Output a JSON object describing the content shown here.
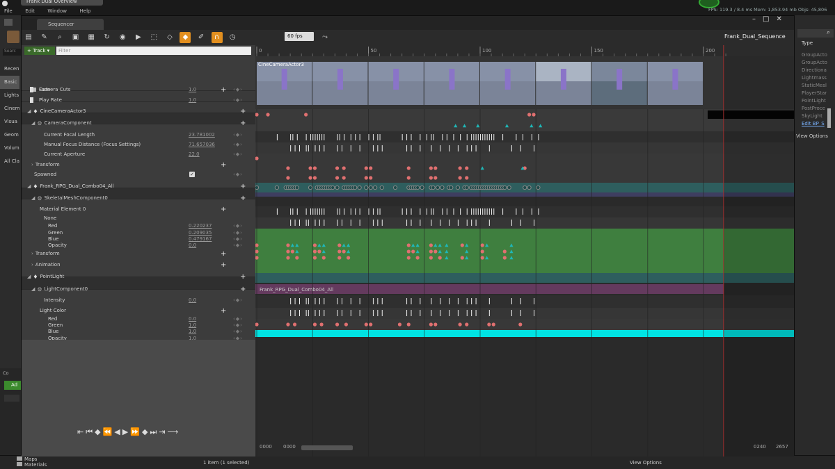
{
  "app": {
    "tab_title": "Frank Dual Overview",
    "menu": [
      "File",
      "Edit",
      "Window",
      "Help"
    ],
    "perf_text": "FPS: 119.3 / 8.4 ms  Mem: 1,853.94 mb  Objs: 45,806"
  },
  "left_panel": {
    "items": [
      "Recen",
      "Basic",
      "Lights",
      "Cinem",
      "Visua",
      "Geom",
      "Volum",
      "All Cla"
    ],
    "search_placeholder": "Searc"
  },
  "right_panel": {
    "type_header": "Type",
    "items": [
      "GroupActo",
      "GroupActo",
      "Directiona",
      "Lightmass",
      "StaticMesl",
      "PlayerStar",
      "PointLight",
      "PostProce",
      "SkyLight",
      "Edit BP_S"
    ],
    "view_options": "View Options"
  },
  "content_browser": {
    "tab": "Co",
    "add_label": "Ad",
    "folders": [
      "Maps",
      "Materials"
    ],
    "status": "1 item (1 selected)",
    "view_options": "View Options"
  },
  "sequencer": {
    "tab_title": "Sequencer",
    "sequence_name": "Frank_Dual_Sequence",
    "fps_label": "60 fps",
    "track_button": "Track",
    "filter_placeholder": "Filter",
    "ruler": [
      "0",
      "50",
      "100",
      "150",
      "200"
    ],
    "camera_cuts": "Camera Cuts",
    "camera_label": "CineCameraActor3",
    "rows": {
      "fade": {
        "label": "Fade",
        "value": "1.0"
      },
      "play_rate": {
        "label": "Play Rate",
        "value": "1.0"
      },
      "cine_camera": {
        "label": "CineCameraActor3"
      },
      "camera_component": {
        "label": "CameraComponent"
      },
      "focal_length": {
        "label": "Current Focal Length",
        "value": "23.781002"
      },
      "manual_focus": {
        "label": "Manual Focus Distance (Focus Settings)",
        "value": "71.657036"
      },
      "aperture": {
        "label": "Current Aperture",
        "value": "22.0"
      },
      "transform_cam": {
        "label": "Transform"
      },
      "spawned": {
        "label": "Spawned"
      },
      "frank_actor": {
        "label": "Frank_RPG_Dual_Combo04_All"
      },
      "skeletal": {
        "label": "SkeletalMeshComponent0"
      },
      "material": {
        "label": "Material Element 0"
      },
      "none": {
        "label": "None"
      },
      "red": {
        "label": "Red",
        "value": "0.220237"
      },
      "green": {
        "label": "Green",
        "value": "0.209035"
      },
      "blue": {
        "label": "Blue",
        "value": "0.479167"
      },
      "opacity": {
        "label": "Opacity",
        "value": "0.0"
      },
      "transform_frank": {
        "label": "Transform"
      },
      "animation": {
        "label": "Animation",
        "section": "Frank_RPG_Dual_Combo04_All"
      },
      "point_light": {
        "label": "PointLight"
      },
      "light_component": {
        "label": "LightComponent0"
      },
      "intensity": {
        "label": "Intensity",
        "value": "0.0"
      },
      "light_color": {
        "label": "Light Color"
      },
      "lc_red": {
        "label": "Red",
        "value": "0.0"
      },
      "lc_green": {
        "label": "Green",
        "value": "1.0"
      },
      "lc_blue": {
        "label": "Blue",
        "value": "1.0"
      },
      "lc_opacity": {
        "label": "Opacity",
        "value": "1.0"
      }
    },
    "bottom": {
      "start_a": "0000",
      "start_b": "0000",
      "end_a": "0240",
      "end_b": "2657"
    }
  },
  "keys": {
    "fade": [
      0,
      5,
      22,
      122,
      124
    ],
    "play_rate_tri": [
      89,
      93,
      99,
      112,
      123,
      127
    ],
    "focal": [
      0
    ],
    "manual": [
      14,
      24,
      26,
      36,
      39,
      49,
      51,
      68,
      78,
      80,
      91,
      94,
      120
    ],
    "manual_tri": [
      101,
      119
    ],
    "aperture": [
      14,
      24,
      26,
      36,
      39,
      49,
      51,
      68,
      78,
      80,
      91,
      94
    ],
    "transform": [
      0,
      9,
      13,
      14,
      15,
      16,
      17,
      18,
      24,
      27,
      28,
      29,
      30,
      31,
      32,
      33,
      34,
      36,
      39,
      40,
      41,
      42,
      43,
      44,
      46,
      49,
      51,
      53,
      56,
      62,
      68,
      69,
      70,
      71,
      72,
      74,
      78,
      79,
      81,
      83,
      86,
      87,
      90,
      93,
      94,
      96,
      97,
      98,
      99,
      100,
      101,
      102,
      103,
      104,
      105,
      106,
      107,
      108,
      109,
      110,
      111,
      113,
      120,
      122,
      126
    ],
    "intensity": [
      0,
      14,
      17,
      26,
      29,
      36,
      40,
      49,
      51,
      64,
      68,
      78,
      80,
      91,
      94,
      104,
      106,
      118
    ],
    "color_pts": [
      [
        0,
        0
      ],
      [
        0,
        1
      ],
      [
        0,
        2
      ],
      [
        14,
        0
      ],
      [
        14,
        1
      ],
      [
        16,
        1
      ],
      [
        14,
        2
      ],
      [
        18,
        2
      ],
      [
        26,
        0
      ],
      [
        26,
        1
      ],
      [
        28,
        1
      ],
      [
        26,
        2
      ],
      [
        30,
        2
      ],
      [
        37,
        0
      ],
      [
        37,
        1
      ],
      [
        39,
        1
      ],
      [
        37,
        2
      ],
      [
        41,
        2
      ],
      [
        68,
        0
      ],
      [
        68,
        1
      ],
      [
        70,
        1
      ],
      [
        68,
        2
      ],
      [
        72,
        2
      ],
      [
        78,
        0
      ],
      [
        78,
        1
      ],
      [
        80,
        1
      ],
      [
        78,
        2
      ],
      [
        82,
        2
      ],
      [
        92,
        0
      ],
      [
        92,
        2
      ],
      [
        101,
        0
      ],
      [
        101,
        1
      ],
      [
        101,
        2
      ],
      [
        111,
        1
      ],
      [
        111,
        2
      ]
    ],
    "color_tris": [
      [
        16,
        0
      ],
      [
        18,
        0
      ],
      [
        18,
        1
      ],
      [
        28,
        0
      ],
      [
        30,
        0
      ],
      [
        30,
        1
      ],
      [
        39,
        0
      ],
      [
        41,
        0
      ],
      [
        41,
        1
      ],
      [
        70,
        0
      ],
      [
        72,
        0
      ],
      [
        72,
        1
      ],
      [
        80,
        0
      ],
      [
        82,
        0
      ],
      [
        82,
        1
      ],
      [
        85,
        0
      ],
      [
        85,
        1
      ],
      [
        85,
        2
      ],
      [
        94,
        0
      ],
      [
        94,
        1
      ],
      [
        94,
        2
      ],
      [
        103,
        0
      ],
      [
        103,
        2
      ],
      [
        114,
        0
      ],
      [
        114,
        1
      ],
      [
        114,
        2
      ]
    ],
    "tick_row_a": [
      9,
      15,
      16,
      18,
      22,
      24,
      25,
      26,
      27,
      28,
      29,
      30,
      36,
      37,
      39,
      42,
      44,
      46,
      50,
      52,
      54,
      55,
      65,
      67,
      69,
      73,
      76,
      78,
      79,
      83,
      85,
      88,
      91,
      94,
      96,
      97,
      98,
      99,
      100,
      101,
      102,
      103,
      104,
      105,
      106,
      110,
      116,
      119,
      123,
      126
    ],
    "tick_row_b": [
      15,
      17,
      19,
      22,
      23,
      26,
      28,
      30,
      36,
      38,
      42,
      46,
      52,
      54,
      56,
      67,
      69,
      73,
      78,
      82,
      86,
      90,
      94,
      96,
      98,
      104,
      114,
      118,
      124
    ]
  }
}
